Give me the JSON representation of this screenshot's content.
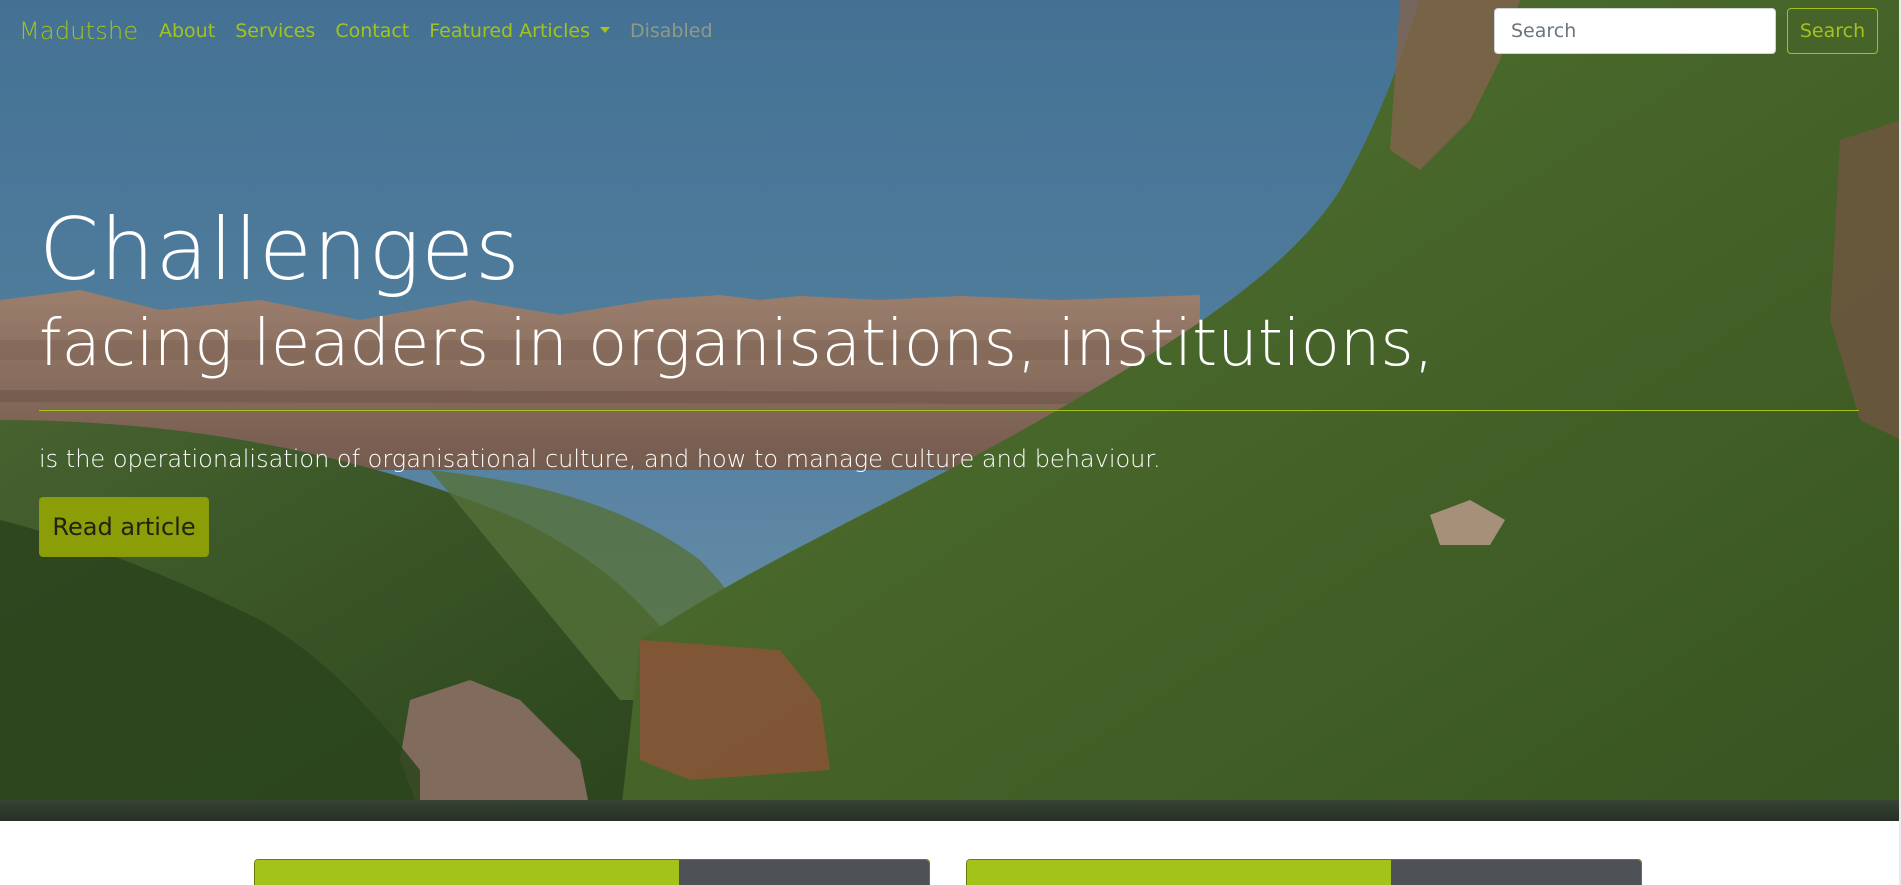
{
  "navbar": {
    "brand": "Madutshe",
    "links": [
      {
        "label": "About"
      },
      {
        "label": "Services"
      },
      {
        "label": "Contact"
      },
      {
        "label": "Featured Articles"
      },
      {
        "label": "Disabled"
      }
    ],
    "search": {
      "placeholder": "Search",
      "button_label": "Search"
    }
  },
  "hero": {
    "title": "Challenges",
    "subtitle": "facing leaders in organisations, institutions,",
    "lead": "is the operationalisation of organisational culture, and how to manage culture and behaviour.",
    "button_label": "Read article"
  },
  "colors": {
    "accent": "#a3c31a",
    "button_bg": "#8b9d07",
    "dark_panel": "#4e5256",
    "disabled_link": "#8f9a86"
  },
  "icons": {
    "dropdown": "chevron-down-icon"
  }
}
